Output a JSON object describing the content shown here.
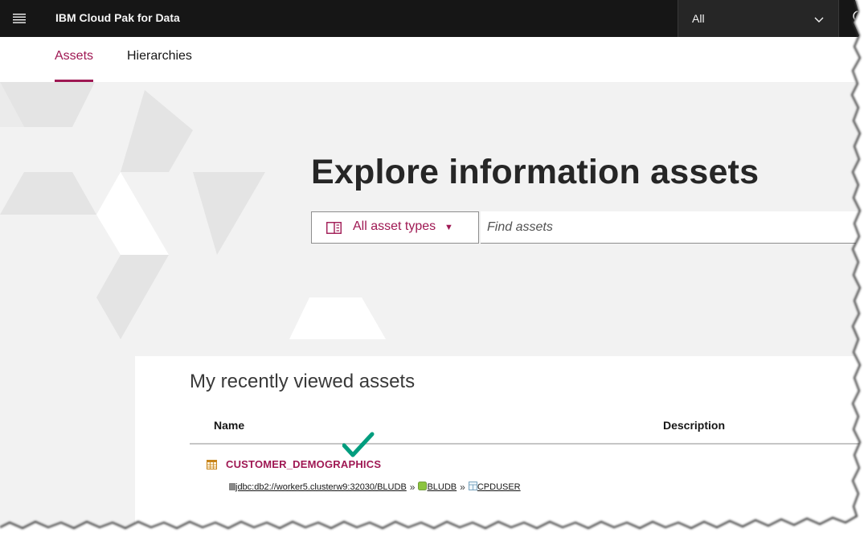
{
  "header": {
    "menu_icon": "hamburger-menu-icon",
    "app_title": "IBM Cloud Pak for Data",
    "scope_value": "All",
    "scope_icon": "chevron-down-icon",
    "search_icon": "search-icon"
  },
  "tabs": [
    {
      "label": "Assets",
      "active": true
    },
    {
      "label": "Hierarchies",
      "active": false
    }
  ],
  "hero": {
    "title": "Explore information assets",
    "asset_type_button": {
      "label": "All asset types",
      "icon": "asset-catalog-icon",
      "caret": "▼"
    },
    "search": {
      "placeholder": "Find assets",
      "value": ""
    }
  },
  "recent": {
    "title": "My recently viewed assets",
    "columns": [
      "Name",
      "Description"
    ],
    "rows": [
      {
        "name": "CUSTOMER_DEMOGRAPHICS",
        "icon": "database-table-icon",
        "description": "",
        "path": [
          {
            "label": "jdbc:db2://worker5.clusterw9:32030/BLUDB",
            "icon": "data-connection-icon"
          },
          {
            "label": "BLUDB",
            "icon": "database-icon"
          },
          {
            "label": "CPDUSER",
            "icon": "schema-icon"
          }
        ],
        "path_separator": "»"
      }
    ]
  },
  "colors": {
    "accent": "#9f1853",
    "topbar": "#161616",
    "checkmark": "#009d7e",
    "hero_bg": "#f2f2f2"
  }
}
